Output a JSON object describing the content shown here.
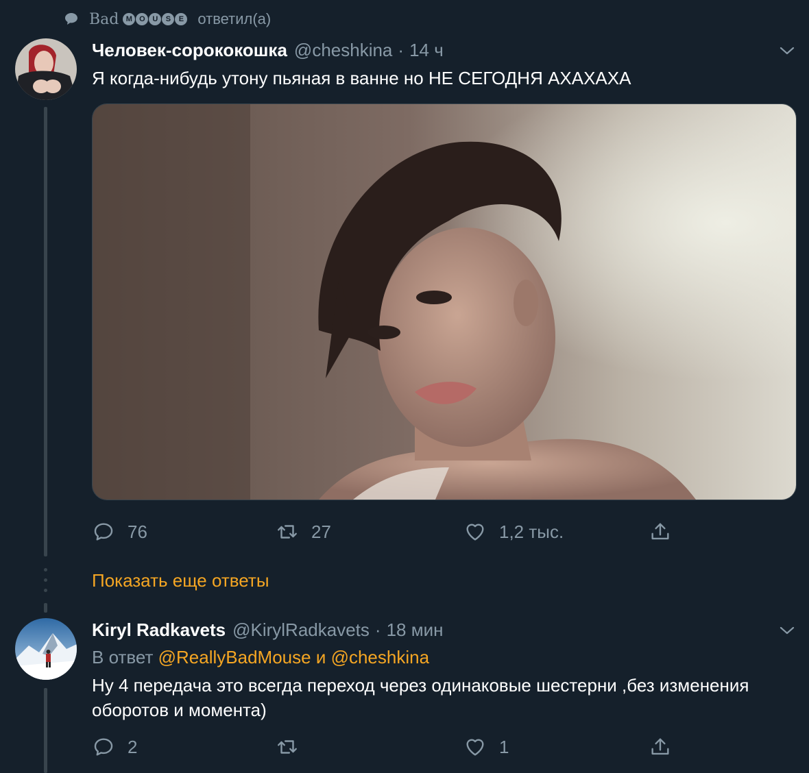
{
  "context": {
    "retweeter_name": "Bad",
    "badge_letters": [
      "M",
      "O",
      "U",
      "S",
      "E"
    ],
    "action_text": "ответил(а)",
    "icon": "speech-bubble-icon"
  },
  "tweet1": {
    "display_name": "Человек-сорококошка",
    "handle": "@cheshkina",
    "separator": "·",
    "time": "14 ч",
    "text": "Я когда-нибудь утону пьяная в ванне но НЕ СЕГОДНЯ АХАХАХА",
    "actions": {
      "replies": "76",
      "retweets": "27",
      "likes": "1,2 тыс."
    }
  },
  "show_more": {
    "label": "Показать еще ответы"
  },
  "tweet2": {
    "display_name": "Kiryl Radkavets",
    "handle": "@KirylRadkavets",
    "separator": "·",
    "time": "18 мин",
    "reply_prefix": "В ответ",
    "reply_user1": "@ReallyBadMouse",
    "reply_and": "и",
    "reply_user2": "@cheshkina",
    "text": "Ну 4 передача это всегда переход через одинаковые шестерни ,без изменения оборотов и момента)",
    "actions": {
      "replies": "2",
      "retweets": "",
      "likes": "1"
    }
  },
  "colors": {
    "background": "#15202b",
    "secondary_text": "#8899a6",
    "accent": "#f5a623",
    "thread_line": "#38444d"
  }
}
